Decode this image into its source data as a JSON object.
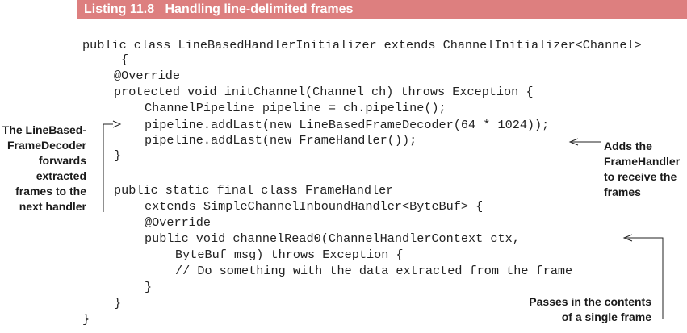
{
  "listing": {
    "label": "Listing 11.8",
    "title": "Handling line-delimited frames"
  },
  "code": [
    "public class LineBasedHandlerInitializer extends ChannelInitializer<Channel>",
    "{",
    "@Override",
    "protected void initChannel(Channel ch) throws Exception {",
    "ChannelPipeline pipeline = ch.pipeline();",
    "pipeline.addLast(new LineBasedFrameDecoder(64 * 1024));",
    "pipeline.addLast(new FrameHandler());",
    "}",
    "public static final class FrameHandler",
    "extends SimpleChannelInboundHandler<ByteBuf> {",
    "@Override",
    "public void channelRead0(ChannelHandlerContext ctx,",
    "ByteBuf msg) throws Exception {",
    "// Do something with the data extracted from the frame",
    "}",
    "}",
    "}"
  ],
  "annotations": {
    "left": [
      "The LineBased-",
      "FrameDecoder",
      "forwards",
      "extracted",
      "frames to the",
      "next handler"
    ],
    "right_top": [
      "Adds the",
      "FrameHandler",
      "to receive the",
      "frames"
    ],
    "right_bottom": [
      "Passes in the contents",
      "of a single frame"
    ]
  }
}
